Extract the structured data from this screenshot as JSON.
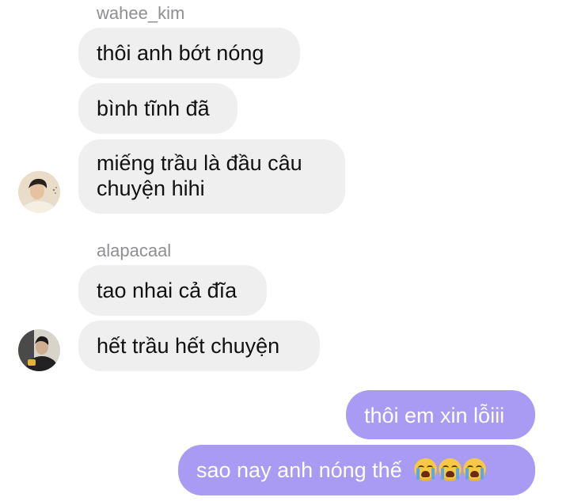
{
  "groups": [
    {
      "sender": "wahee_kim",
      "avatar": "avatar-young-man-light-shirt",
      "messages": [
        "thôi anh bớt nóng",
        "bình tĩnh đã",
        "miếng trầu là đầu câu",
        "chuyện hihi"
      ]
    },
    {
      "sender": "alapacaal",
      "avatar": "avatar-person-dark-clothes",
      "messages": [
        "tao nhai cả đĩa",
        "hết trầu hết chuyện"
      ]
    }
  ],
  "outgoing": {
    "messages": [
      "thôi em xin lỗiii",
      "sao nay anh nóng thế"
    ],
    "emoji": "loudly-crying-face-icon",
    "emoji_count": 3
  },
  "colors": {
    "incoming_bubble": "#efeff0",
    "outgoing_bubble": "#a99af3",
    "sender_name": "#8e8e93"
  }
}
